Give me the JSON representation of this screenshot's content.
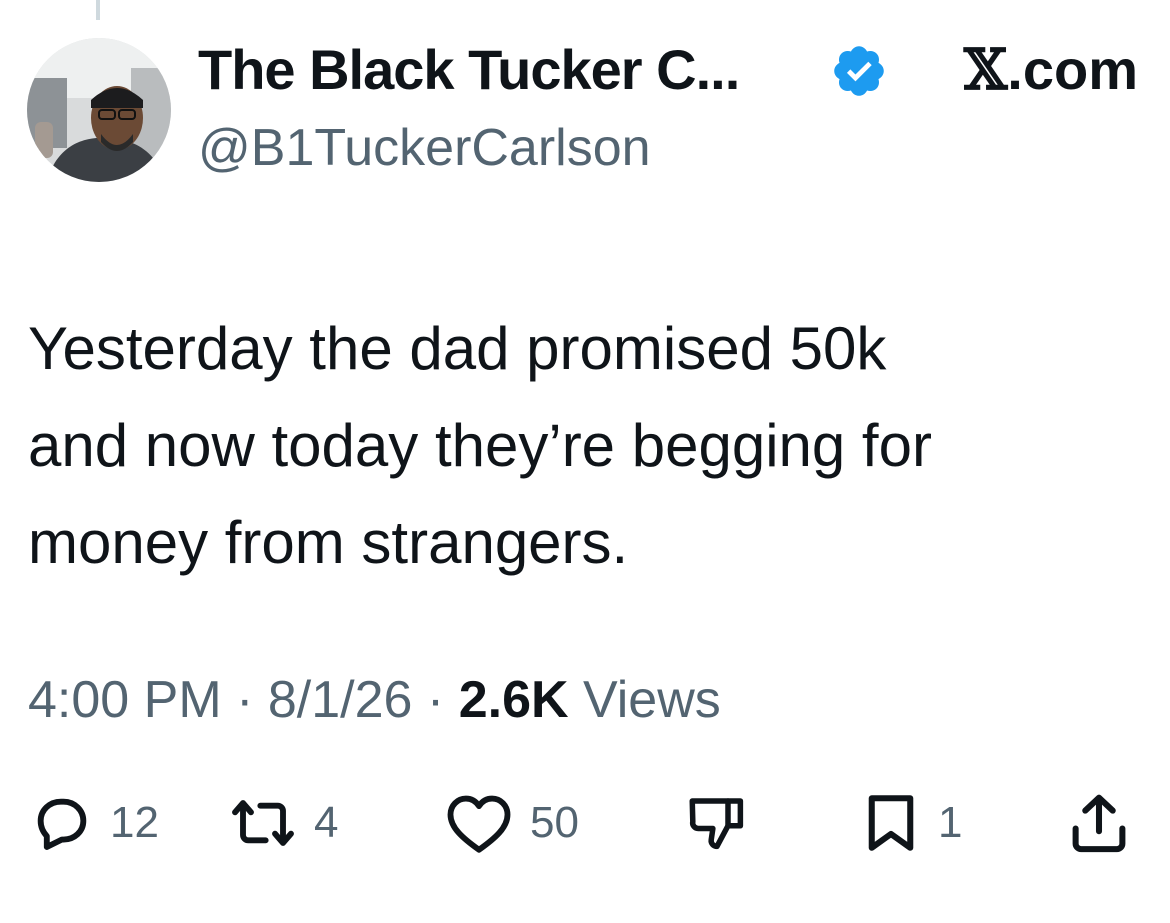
{
  "author": {
    "display_name": "The Black Tucker C...",
    "handle": "@B1TuckerCarlson",
    "verified": true
  },
  "source": {
    "x_glyph": "𝕏",
    "domain": ".com"
  },
  "tweet": {
    "text_lines": [
      "Yesterday the dad promised 50k",
      "and now today they’re begging for",
      "money from strangers."
    ]
  },
  "meta": {
    "time": "4:00 PM",
    "sep1": "·",
    "date": "8/1/26",
    "sep2": "·",
    "views_count": "2.6K",
    "views_label": "Views"
  },
  "actions": {
    "reply": {
      "icon": "reply-icon",
      "count": "12"
    },
    "retweet": {
      "icon": "retweet-icon",
      "count": "4"
    },
    "like": {
      "icon": "heart-icon",
      "count": "50"
    },
    "dislike": {
      "icon": "thumbs-down-icon"
    },
    "bookmark": {
      "icon": "bookmark-icon",
      "count": "1"
    },
    "share": {
      "icon": "share-icon"
    }
  },
  "colors": {
    "text": "#0f1419",
    "secondary": "#536471",
    "verified": "#1d9bf0",
    "thread_line": "#cfd9de"
  }
}
